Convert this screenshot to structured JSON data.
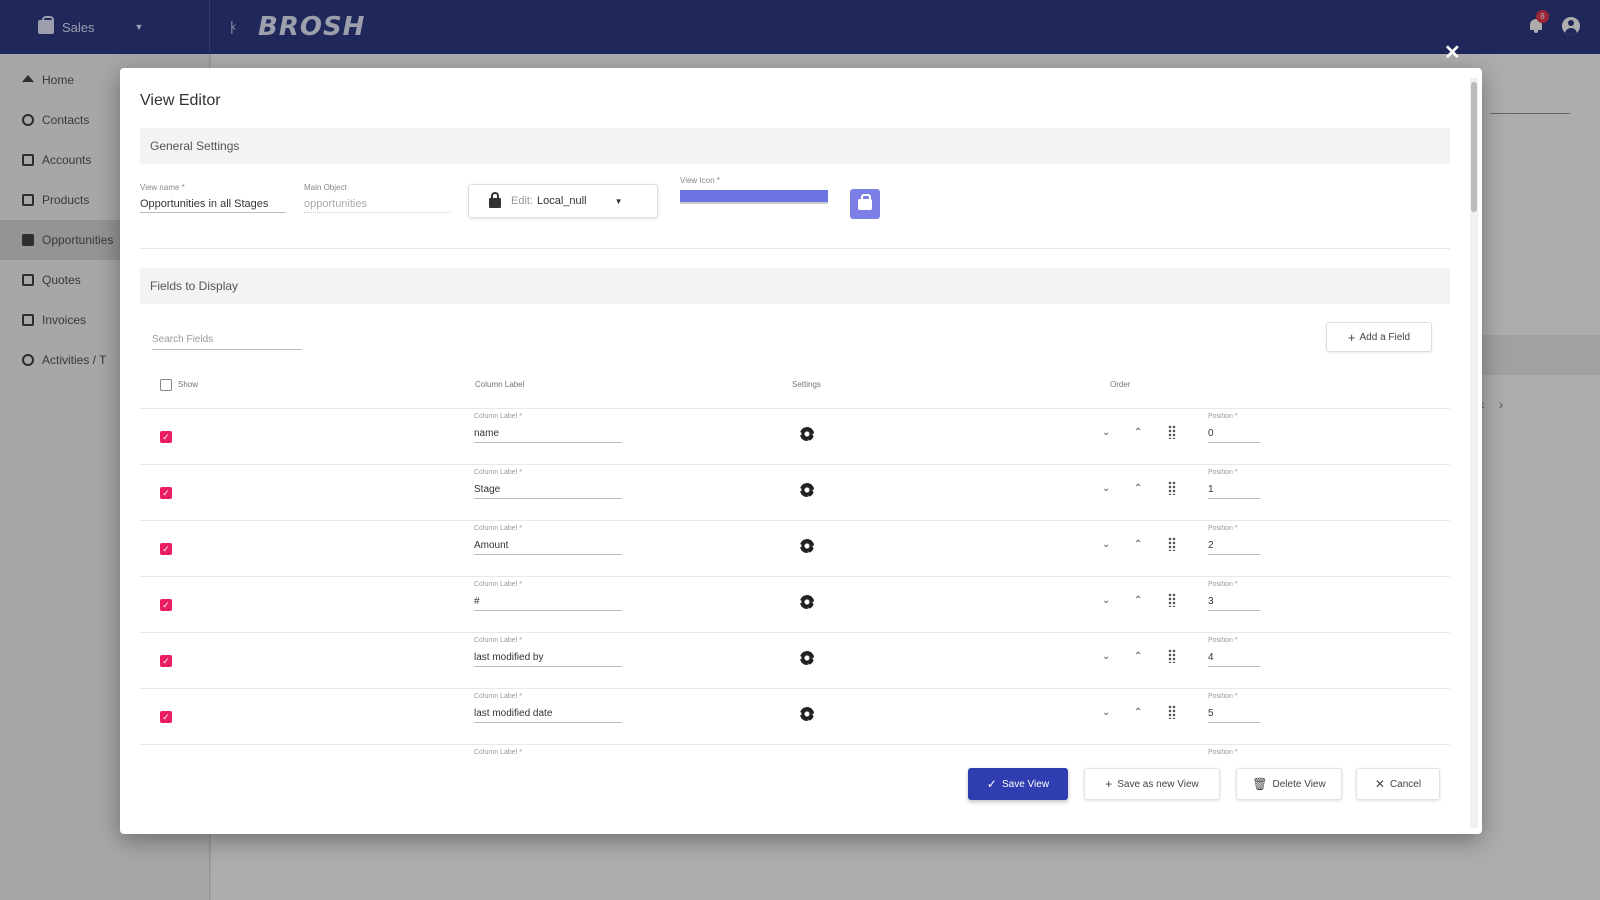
{
  "topbar": {
    "module": "Sales",
    "brand": "BROSH",
    "notification_count": "8"
  },
  "sidebar": {
    "items": [
      {
        "label": "Home"
      },
      {
        "label": "Contacts"
      },
      {
        "label": "Accounts"
      },
      {
        "label": "Products"
      },
      {
        "label": "Opportunities"
      },
      {
        "label": "Quotes"
      },
      {
        "label": "Invoices"
      },
      {
        "label": "Activities / T"
      }
    ]
  },
  "dialog": {
    "title": "View Editor",
    "general_settings": {
      "header": "General Settings",
      "view_name_label": "View name *",
      "view_name_value": "Opportunities in all Stages",
      "main_object_label": "Main Object",
      "main_object_value": "opportunities",
      "locale_prefix": "Edit:",
      "locale_value": "Local_null",
      "view_icon_label": "View Icon *"
    },
    "fields_to_display": {
      "header": "Fields to Display",
      "search_placeholder": "Search Fields",
      "add_field_label": "Add a Field",
      "columns": {
        "show": "Show",
        "column_label": "Column Label",
        "settings": "Settings",
        "order": "Order"
      },
      "rows": [
        {
          "label_caption": "Column Label *",
          "label": "name",
          "position_caption": "Position *",
          "position": "0"
        },
        {
          "label_caption": "Column Label *",
          "label": "Stage",
          "position_caption": "Position *",
          "position": "1"
        },
        {
          "label_caption": "Column Label *",
          "label": "Amount",
          "position_caption": "Position *",
          "position": "2"
        },
        {
          "label_caption": "Column Label *",
          "label": "#",
          "position_caption": "Position *",
          "position": "3"
        },
        {
          "label_caption": "Column Label *",
          "label": "last modified by",
          "position_caption": "Position *",
          "position": "4"
        },
        {
          "label_caption": "Column Label *",
          "label": "last modified date",
          "position_caption": "Position *",
          "position": "5"
        },
        {
          "label_caption": "Column Label *",
          "label": "",
          "position_caption": "Position *",
          "position": ""
        }
      ]
    },
    "footer": {
      "save": "Save View",
      "save_as": "Save as new View",
      "delete": "Delete View",
      "cancel": "Cancel"
    }
  },
  "colors": {
    "topbar": "#2f3a86",
    "primary_button": "#2f3db0",
    "checkbox": "#e91e63",
    "view_icon": "#6d73e0"
  }
}
